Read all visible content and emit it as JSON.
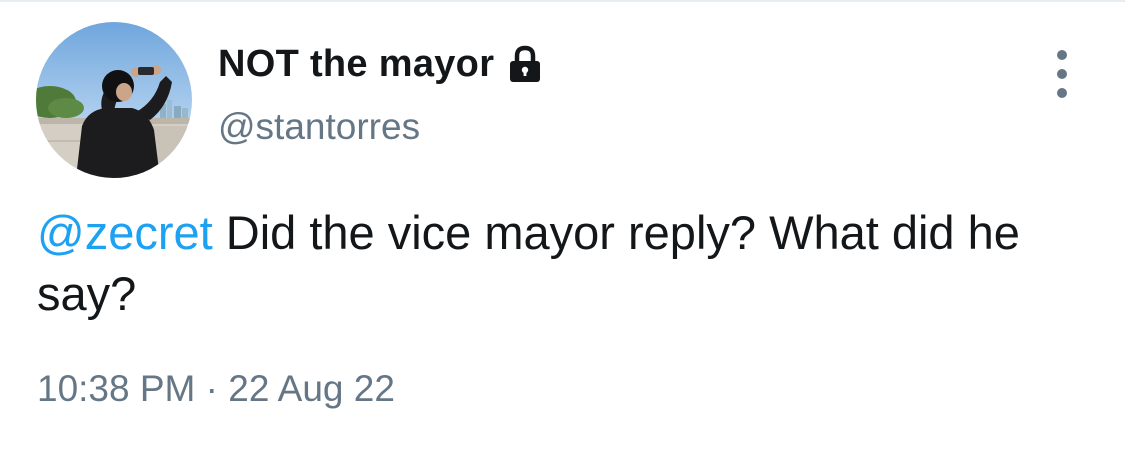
{
  "user": {
    "display_name": "NOT the mayor",
    "handle": "@stantorres",
    "protected_icon": "lock-icon",
    "avatar": "profile-photo"
  },
  "menu": {
    "icon": "more-vertical-icon"
  },
  "tweet": {
    "mention": "@zecret",
    "body": " Did the vice mayor reply? What did he say?",
    "timestamp": "10:38 PM · 22 Aug 22"
  },
  "colors": {
    "link": "#1da1f2",
    "text": "#14171a",
    "secondary": "#657786"
  }
}
